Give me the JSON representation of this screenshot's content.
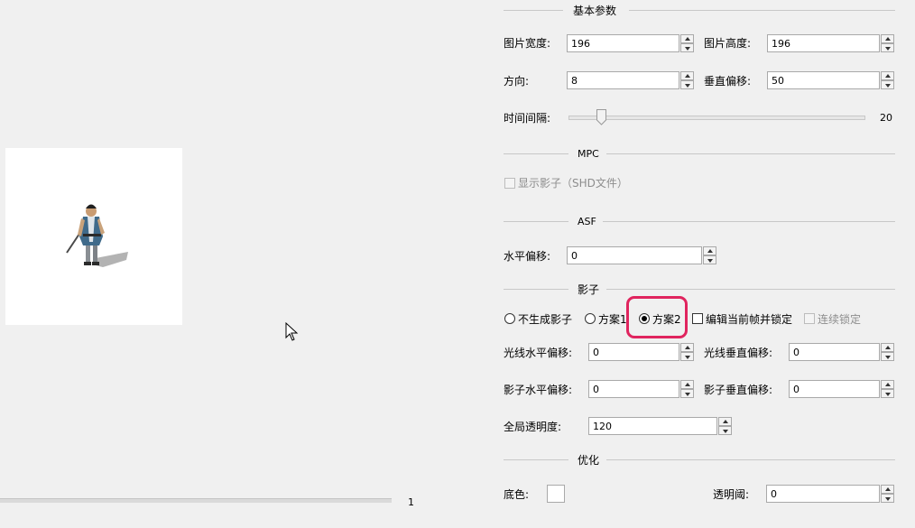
{
  "basic": {
    "title": "基本参数",
    "width_label": "图片宽度:",
    "width_value": "196",
    "height_label": "图片高度:",
    "height_value": "196",
    "direction_label": "方向:",
    "direction_value": "8",
    "voffset_label": "垂直偏移:",
    "voffset_value": "50",
    "interval_label": "时间间隔:",
    "interval_value": "20",
    "interval_level": 0.11
  },
  "mpc": {
    "title": "MPC",
    "show_shadow_label": "显示影子（SHD文件）",
    "show_shadow_checked": false
  },
  "asf": {
    "title": "ASF",
    "hoffset_label": "水平偏移:",
    "hoffset_value": "0"
  },
  "shadow": {
    "title": "影子",
    "opt_none_label": "不生成影子",
    "opt1_label": "方案1",
    "opt2_label": "方案2",
    "selected": "方案2",
    "edit_frame_label": "编辑当前帧并锁定",
    "continuous_lock_label": "连续锁定",
    "light_h_label": "光线水平偏移:",
    "light_h_value": "0",
    "light_v_label": "光线垂直偏移:",
    "light_v_value": "0",
    "shadow_h_label": "影子水平偏移:",
    "shadow_h_value": "0",
    "shadow_v_label": "影子垂直偏移:",
    "shadow_v_value": "0",
    "global_alpha_label": "全局透明度:",
    "global_alpha_value": "120",
    "highlight_color": "#e0245e"
  },
  "optimize": {
    "title": "优化",
    "bg_color_label": "底色:",
    "bg_color": "#ffffff",
    "threshold_label": "透明阈:",
    "threshold_value": "0"
  },
  "preview": {
    "frame_number": "1",
    "canvas_color": "#ffffff"
  }
}
